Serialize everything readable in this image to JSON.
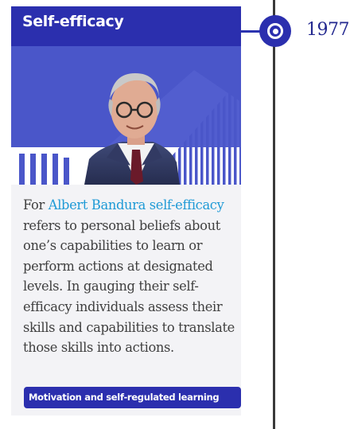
{
  "card": {
    "title": "Self-efficacy",
    "body_link": "Albert Bandura self-efficacy",
    "body_prefix": "For ",
    "body_rest": " refers to personal beliefs about one’s capabilities to learn or perform actions at designated levels. In gauging their self-efficacy individuals assess their skills and capabilities to translate those skills into actions.",
    "tag_label": "Motivation and self-regulated learning",
    "portrait_icon": "portrait-photo"
  },
  "timeline": {
    "year": "1977",
    "marker_icon": "target-icon"
  },
  "colors": {
    "brand_blue": "#2b2fae",
    "link_blue": "#1f9ad6",
    "text": "#3f3f3f",
    "card_bg": "#f3f3f6"
  }
}
